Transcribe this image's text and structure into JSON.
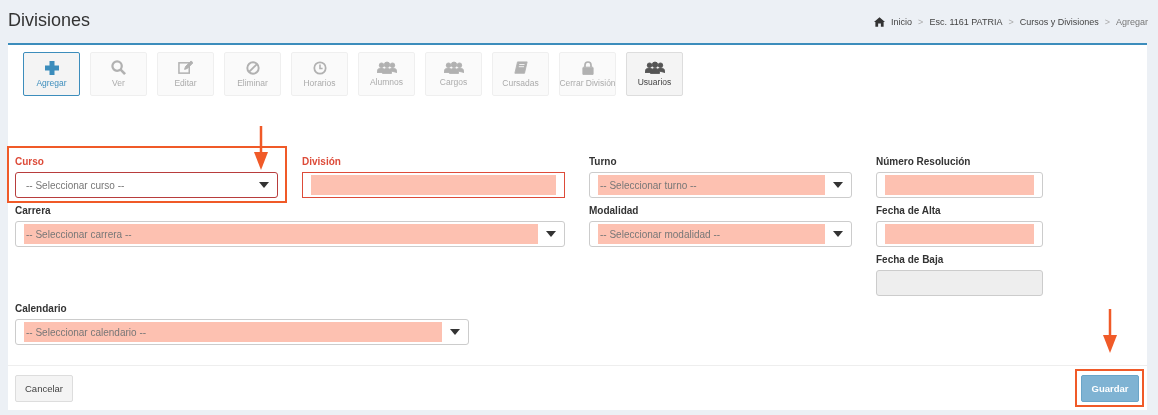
{
  "header": {
    "title": "Divisiones",
    "breadcrumb": [
      {
        "kind": "link",
        "text": "Inicio"
      },
      {
        "kind": "separator",
        "text": ">"
      },
      {
        "kind": "link",
        "text": "Esc. 1161 PATRIA"
      },
      {
        "kind": "separator",
        "text": ">"
      },
      {
        "kind": "link",
        "text": "Cursos y Divisiones"
      },
      {
        "kind": "separator",
        "text": ">"
      },
      {
        "kind": "current",
        "text": "Agregar"
      }
    ]
  },
  "toolbar": [
    {
      "label": "Agregar",
      "selected": true,
      "disabled": false
    },
    {
      "label": "Ver",
      "selected": false,
      "disabled": true
    },
    {
      "label": "Editar",
      "selected": false,
      "disabled": true
    },
    {
      "label": "Eliminar",
      "selected": false,
      "disabled": true
    },
    {
      "label": "Horarios",
      "selected": false,
      "disabled": true
    },
    {
      "label": "Alumnos",
      "selected": false,
      "disabled": true
    },
    {
      "label": "Cargos",
      "selected": false,
      "disabled": true
    },
    {
      "label": "Cursadas",
      "selected": false,
      "disabled": true
    },
    {
      "label": "Cerrar División",
      "selected": false,
      "disabled": true
    },
    {
      "label": "Usuarios",
      "selected": false,
      "disabled": false
    }
  ],
  "form": {
    "left_top": [
      {
        "label": "Curso",
        "kind": "select",
        "placeholder": "-- Seleccionar curso --",
        "error": true,
        "highlighted": false
      },
      {
        "label": "División",
        "kind": "text",
        "error": true,
        "highlighted": true
      }
    ],
    "left_wide": {
      "label": "Carrera",
      "kind": "select",
      "placeholder": "-- Seleccionar carrera --",
      "error": false,
      "highlighted": true
    },
    "middle": [
      {
        "label": "Turno",
        "kind": "select",
        "placeholder": "-- Seleccionar turno --",
        "error": false,
        "highlighted": true
      },
      {
        "label": "Modalidad",
        "kind": "select",
        "placeholder": "-- Seleccionar modalidad --",
        "error": false,
        "highlighted": true
      }
    ],
    "right": [
      {
        "label": "Número Resolución",
        "kind": "text",
        "error": false,
        "highlighted": true
      },
      {
        "label": "Fecha de Alta",
        "kind": "text",
        "error": false,
        "highlighted": true
      },
      {
        "label": "Fecha de Baja",
        "kind": "readonly",
        "error": false,
        "highlighted": false
      }
    ],
    "bottom": {
      "label": "Calendario",
      "kind": "select",
      "placeholder": "-- Seleccionar calendario --",
      "error": false,
      "highlighted": true
    }
  },
  "footer": {
    "cancel": {
      "label": "Cancelar"
    },
    "save": {
      "label": "Guardar"
    }
  },
  "annotations": [
    {
      "kind": "field_callout"
    },
    {
      "kind": "button_callout"
    }
  ]
}
